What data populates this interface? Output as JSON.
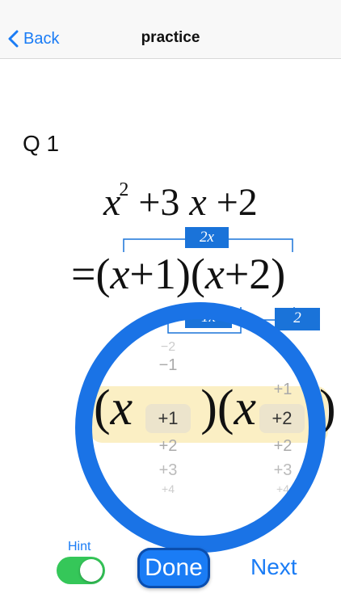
{
  "nav": {
    "back_label": "Back",
    "title": "practice"
  },
  "question": {
    "label": "Q 1"
  },
  "expression": {
    "var": "x",
    "exp": "2",
    "coef": "+3",
    "const": "+2",
    "factored_prefix": "=(",
    "f1_const": "+1",
    "f2_const": "+2",
    "close_open": ")(",
    "close": ")"
  },
  "tags": {
    "sum_tag": "2x",
    "left_tag": "1x",
    "right_tag": "2"
  },
  "wheel_left": {
    "items_above": [
      "−2",
      "−1"
    ],
    "selected": "+1",
    "items_below": [
      "+2",
      "+3",
      "+4"
    ]
  },
  "wheel_right": {
    "items_above": [
      "+1"
    ],
    "selected": "+2",
    "items_below": [
      "+2",
      "+3",
      "+4"
    ]
  },
  "controls": {
    "hint_label": "Hint",
    "hint_on": true,
    "done_label": "Done",
    "next_label": "Next"
  },
  "colors": {
    "accent": "#1a7cf5",
    "tag_blue": "#1a73d9",
    "ring": "#1a73e6",
    "band": "#fbefc4",
    "toggle_on": "#35c759"
  },
  "icons": {
    "back": "chevron-left-icon"
  }
}
